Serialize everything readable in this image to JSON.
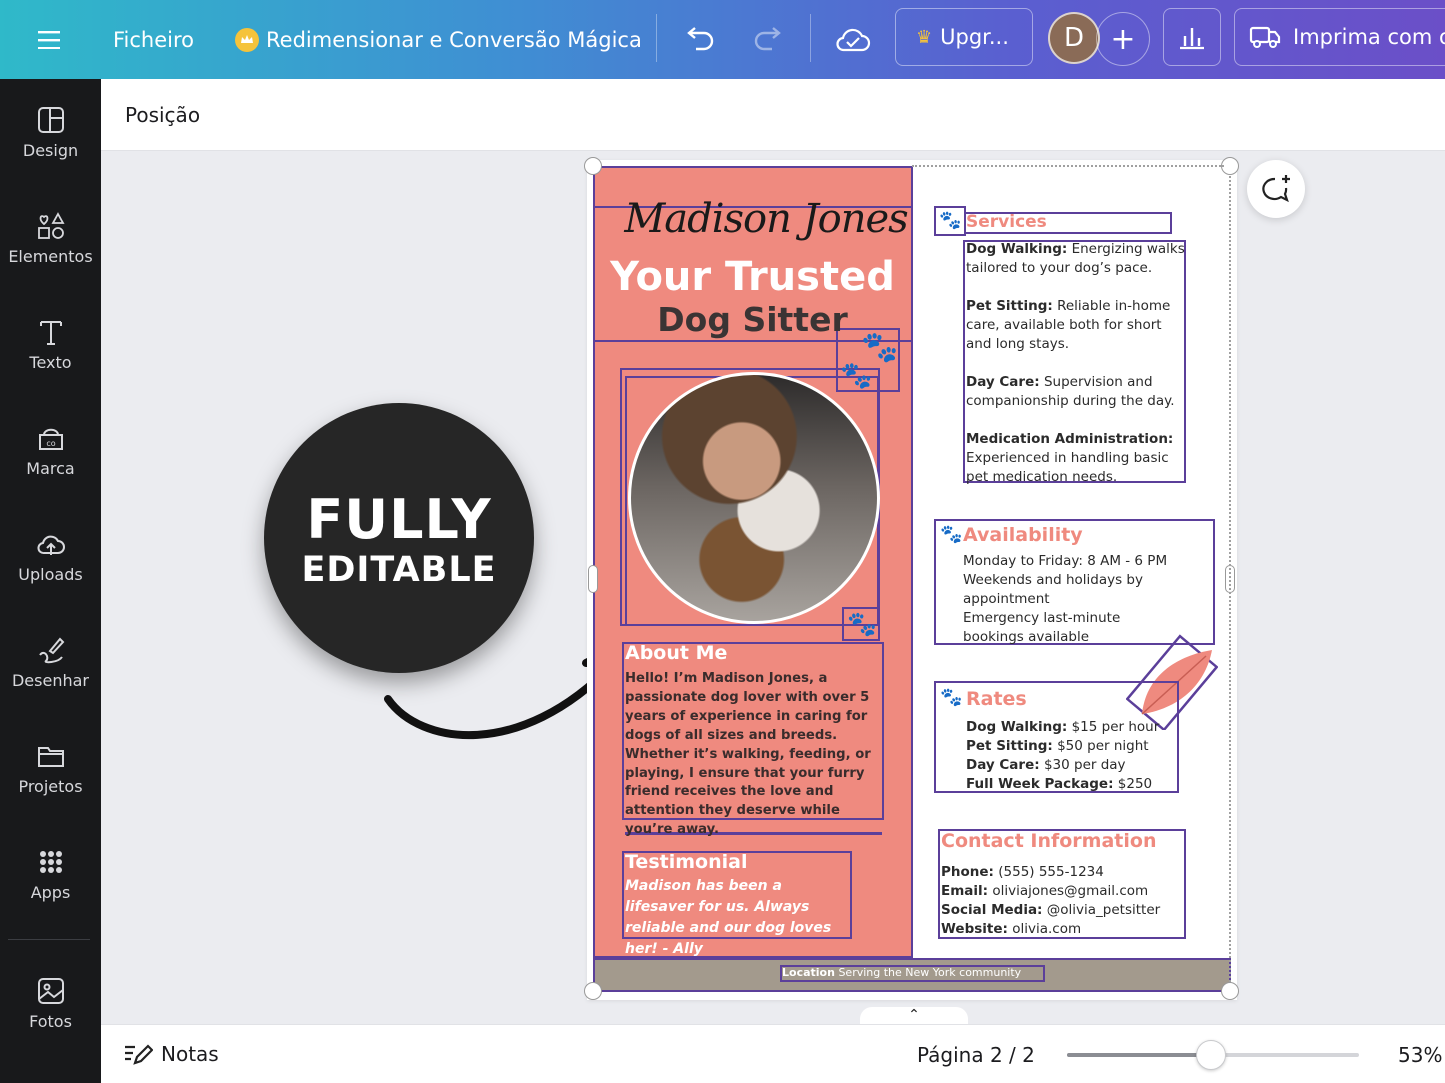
{
  "topbar": {
    "file": "Ficheiro",
    "magic_resize": "Redimensionar e Conversão Mágica",
    "upgrade": "Upgr...",
    "avatar_initial": "D",
    "print": "Imprima com o"
  },
  "sidebar": {
    "items": [
      {
        "label": "Design",
        "icon": "design-icon"
      },
      {
        "label": "Elementos",
        "icon": "shapes-icon"
      },
      {
        "label": "Texto",
        "icon": "text-icon"
      },
      {
        "label": "Marca",
        "icon": "brand-icon"
      },
      {
        "label": "Uploads",
        "icon": "cloud-upload-icon"
      },
      {
        "label": "Desenhar",
        "icon": "draw-icon"
      },
      {
        "label": "Projetos",
        "icon": "folder-icon"
      },
      {
        "label": "Apps",
        "icon": "grid-icon"
      },
      {
        "label": "Fotos",
        "icon": "image-icon"
      }
    ]
  },
  "position_header": "Posição",
  "badge": {
    "line1": "FULLY",
    "line2": "EDITABLE"
  },
  "flyer": {
    "name_script": "Madison Jones",
    "headline": "Your Trusted",
    "subheadline": "Dog Sitter",
    "about_title": "About Me",
    "about_text": "Hello! I’m Madison Jones, a passionate dog lover with over 5 years of experience in caring for dogs of all sizes and breeds. Whether it’s walking, feeding, or playing, I ensure that your furry friend receives the love and attention they deserve while you’re away.",
    "testimonial_title": "Testimonial",
    "testimonial_text": "Madison has been a lifesaver for us. Always reliable and our dog loves her! - Ally",
    "services_title": "Services",
    "services": [
      {
        "label": "Dog Walking:",
        "text": "Energizing walks tailored to your dog’s pace."
      },
      {
        "label": "Pet Sitting:",
        "text": "Reliable in-home care, available both for short and long stays."
      },
      {
        "label": "Day Care:",
        "text": "Supervision and companionship during the day."
      },
      {
        "label": "Medication Administration:",
        "text": "Experienced in handling basic pet medication needs."
      }
    ],
    "availability_title": "Availability",
    "availability": [
      "Monday to Friday: 8 AM - 6 PM",
      "Weekends and holidays by appointment",
      "Emergency last-minute bookings available"
    ],
    "rates_title": "Rates",
    "rates": [
      {
        "label": "Dog Walking:",
        "text": "$15 per hour"
      },
      {
        "label": "Pet Sitting:",
        "text": "$50 per night"
      },
      {
        "label": "Day Care:",
        "text": "$30 per day"
      },
      {
        "label": "Full Week Package:",
        "text": "$250"
      }
    ],
    "contact_title": "Contact Information",
    "contact": [
      {
        "label": "Phone:",
        "text": "(555) 555-1234"
      },
      {
        "label": "Email:",
        "text": "oliviajones@gmail.com"
      },
      {
        "label": "Social Media:",
        "text": "@olivia_petsitter"
      },
      {
        "label": "Website:",
        "text": "olivia.com"
      }
    ],
    "location_label": "Location",
    "location_text": "Serving the New York community"
  },
  "bottombar": {
    "notes": "Notas",
    "page_indicator": "Página 2 / 2",
    "zoom": "53%",
    "zoom_fraction": 0.53
  },
  "colors": {
    "accent_coral": "#ef8a7f",
    "outline_purple": "#5b3f9a",
    "sidebar_bg": "#18191b",
    "footer_strip": "#a39a8d"
  }
}
